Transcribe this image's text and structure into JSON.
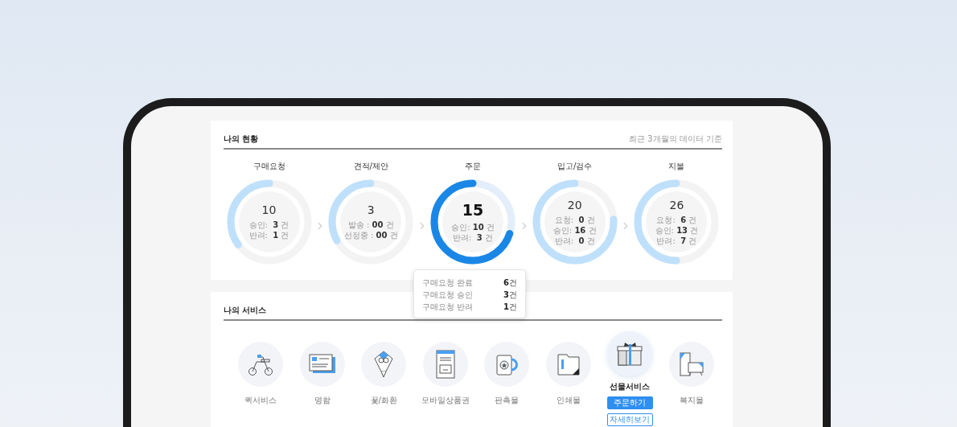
{
  "status": {
    "title": "나의 현황",
    "note": "최근 3개월의 데이터 기준",
    "stages": [
      {
        "label": "구매요청",
        "total": "10",
        "level": 0.35,
        "selected": false,
        "lines": [
          "승인:  **3** 건",
          "반려:  **1** 건"
        ]
      },
      {
        "label": "견적/제안",
        "total": "3",
        "level": 0.33,
        "selected": false,
        "lines": [
          "발송 : **00** 건",
          "선정중 : **00** 건"
        ]
      },
      {
        "label": "주문",
        "total": "15",
        "level": 0.7,
        "selected": true,
        "lines": [
          "승인: **10** 건",
          "반려:  **3** 건"
        ]
      },
      {
        "label": "입고/검수",
        "total": "20",
        "level": 0.76,
        "selected": false,
        "lines": [
          "요청:  **0** 건",
          "승인: **16** 건",
          "반려:  **0** 건"
        ]
      },
      {
        "label": "지불",
        "total": "26",
        "level": 0.5,
        "selected": false,
        "lines": [
          "요청:  **6** 건",
          "승인: **13** 건",
          "반려:  **7** 건"
        ]
      }
    ],
    "tooltip": [
      {
        "label": "구매요청 완료",
        "value": "**6**건"
      },
      {
        "label": "구매요청 승인",
        "value": "**3**건"
      },
      {
        "label": "구매요청 반려",
        "value": "**1**건"
      }
    ]
  },
  "services": {
    "title": "나의 서비스",
    "items": [
      {
        "label": "퀵서비스",
        "selected": false
      },
      {
        "label": "명함",
        "selected": false
      },
      {
        "label": "꽃/화환",
        "selected": false
      },
      {
        "label": "모바일상품권",
        "selected": false
      },
      {
        "label": "판촉물",
        "selected": false
      },
      {
        "label": "인쇄물",
        "selected": false
      },
      {
        "label": "선물서비스",
        "selected": true,
        "buttons": [
          "주문하기",
          "자세히보기"
        ]
      },
      {
        "label": "복지몰",
        "selected": false
      }
    ]
  }
}
